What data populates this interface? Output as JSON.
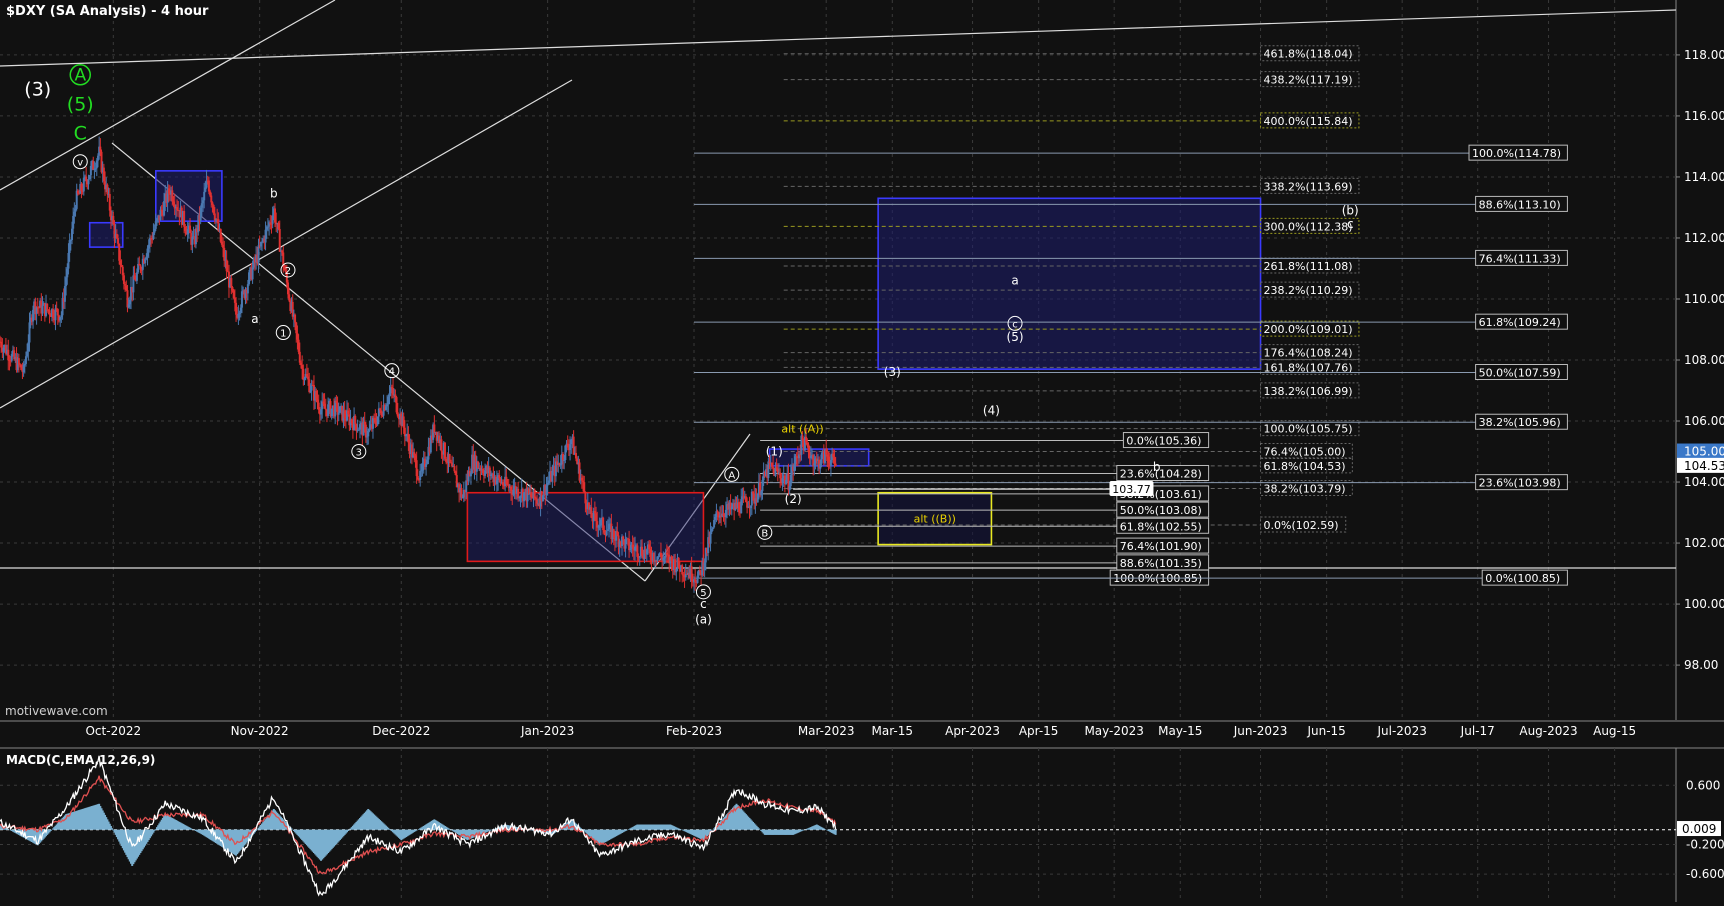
{
  "header": {
    "title": "$DXY (SA Analysis) - 4 hour"
  },
  "watermark": "motivewave.com",
  "colors": {
    "background": "#111111",
    "grid": "#3a3a3a",
    "candle_up": "#4a78b0",
    "candle_down": "#e03030",
    "blue_box": "#1f1f6a",
    "red_box": "#e01a1a",
    "yellow_box": "#e8e820",
    "green_label": "#22dd22",
    "yellow_label": "#e8d000",
    "macd_hist": "#7ab0d0",
    "macd_line": "#ffffff",
    "signal_line": "#e05050"
  },
  "chart_data": [
    {
      "type": "candlestick",
      "title": "$DXY (SA Analysis) - 4 hour",
      "x_ticks": [
        "Oct-2022",
        "Nov-2022",
        "Dec-2022",
        "Jan-2023",
        "Feb-2023",
        "Mar-2023",
        "Mar-15",
        "Apr-2023",
        "Apr-15",
        "May-2023",
        "May-15",
        "Jun-2023",
        "Jun-15",
        "Jul-2023",
        "Jul-17",
        "Aug-2023",
        "Aug-15"
      ],
      "y_ticks": [
        "98.00",
        "100.00",
        "102.00",
        "104.00",
        "106.00",
        "108.00",
        "110.00",
        "112.00",
        "114.00",
        "116.00",
        "118.00"
      ],
      "ylim": [
        96.2,
        119.8
      ],
      "x_range": [
        "2022-09-07",
        "2023-08-28"
      ],
      "grid": true,
      "price_badges": {
        "last": "105.00",
        "current": "104.53"
      },
      "pivots": [
        {
          "date": "2022-09-07",
          "price": 108.6
        },
        {
          "date": "2022-09-12",
          "price": 107.6
        },
        {
          "date": "2022-09-14",
          "price": 109.8
        },
        {
          "date": "2022-09-20",
          "price": 109.5
        },
        {
          "date": "2022-09-23",
          "price": 113.2
        },
        {
          "date": "2022-09-28",
          "price": 114.78
        },
        {
          "date": "2022-10-04",
          "price": 110.0
        },
        {
          "date": "2022-10-13",
          "price": 113.6
        },
        {
          "date": "2022-10-18",
          "price": 111.8
        },
        {
          "date": "2022-10-21",
          "price": 113.9
        },
        {
          "date": "2022-10-27",
          "price": 109.5
        },
        {
          "date": "2022-11-04",
          "price": 112.9
        },
        {
          "date": "2022-11-10",
          "price": 107.7
        },
        {
          "date": "2022-11-14",
          "price": 106.4
        },
        {
          "date": "2022-11-17",
          "price": 106.4
        },
        {
          "date": "2022-11-24",
          "price": 105.6
        },
        {
          "date": "2022-11-29",
          "price": 107.0
        },
        {
          "date": "2022-12-05",
          "price": 104.1
        },
        {
          "date": "2022-12-08",
          "price": 105.8
        },
        {
          "date": "2022-12-14",
          "price": 103.5
        },
        {
          "date": "2022-12-16",
          "price": 104.7
        },
        {
          "date": "2022-12-23",
          "price": 103.9
        },
        {
          "date": "2022-12-30",
          "price": 103.4
        },
        {
          "date": "2023-01-06",
          "price": 105.4
        },
        {
          "date": "2023-01-10",
          "price": 102.9
        },
        {
          "date": "2023-01-18",
          "price": 101.9
        },
        {
          "date": "2023-01-26",
          "price": 101.5
        },
        {
          "date": "2023-02-02",
          "price": 100.85
        },
        {
          "date": "2023-02-06",
          "price": 103.0
        },
        {
          "date": "2023-02-09",
          "price": 103.1
        },
        {
          "date": "2023-02-14",
          "price": 103.5
        },
        {
          "date": "2023-02-17",
          "price": 104.5
        },
        {
          "date": "2023-02-21",
          "price": 104.0
        },
        {
          "date": "2023-02-24",
          "price": 105.36
        },
        {
          "date": "2023-02-27",
          "price": 104.6
        },
        {
          "date": "2023-03-01",
          "price": 104.9
        },
        {
          "date": "2023-03-03",
          "price": 104.53
        }
      ],
      "fib_levels_mid": [
        {
          "label": "461.8%(118.04)",
          "price": 118.04,
          "color": "#bbbbbb"
        },
        {
          "label": "438.2%(117.19)",
          "price": 117.19,
          "color": "#bbbbbb"
        },
        {
          "label": "400.0%(115.84)",
          "price": 115.84,
          "color": "#e8e820"
        },
        {
          "label": "338.2%(113.69)",
          "price": 113.69,
          "color": "#bbbbbb"
        },
        {
          "label": "300.0%(112.38)",
          "price": 112.38,
          "color": "#e8e820"
        },
        {
          "label": "261.8%(111.08)",
          "price": 111.08,
          "color": "#bbbbbb"
        },
        {
          "label": "238.2%(110.29)",
          "price": 110.29,
          "color": "#bbbbbb"
        },
        {
          "label": "200.0%(109.01)",
          "price": 109.01,
          "color": "#e8e820"
        },
        {
          "label": "176.4%(108.24)",
          "price": 108.24,
          "color": "#bbbbbb"
        },
        {
          "label": "161.8%(107.76)",
          "price": 107.76,
          "color": "#bbbbbb"
        },
        {
          "label": "138.2%(106.99)",
          "price": 106.99,
          "color": "#bbbbbb"
        },
        {
          "label": "100.0%(105.75)",
          "price": 105.75,
          "color": "#bbbbbb"
        },
        {
          "label": "76.4%(105.00)",
          "price": 105.0,
          "color": "#bbbbbb"
        },
        {
          "label": "61.8%(104.53)",
          "price": 104.53,
          "color": "#bbbbbb"
        },
        {
          "label": "38.2%(103.79)",
          "price": 103.79,
          "color": "#bbbbbb"
        },
        {
          "label": "0.0%(102.59)",
          "price": 102.59,
          "color": "#bbbbbb"
        }
      ],
      "fib_levels_retrace": [
        {
          "label": "0.0%(105.36)",
          "price": 105.36
        },
        {
          "label": "23.6%(104.28)",
          "price": 104.28
        },
        {
          "label": "38.2%(103.61)",
          "price": 103.61
        },
        {
          "label": "50.0%(103.08)",
          "price": 103.08
        },
        {
          "label": "61.8%(102.55)",
          "price": 102.55
        },
        {
          "label": "76.4%(101.90)",
          "price": 101.9
        },
        {
          "label": "88.6%(101.35)",
          "price": 101.35
        },
        {
          "label": "100.0%(100.85)",
          "price": 100.85
        }
      ],
      "fib_levels_right": [
        {
          "label": "100.0%(114.78)",
          "price": 114.78
        },
        {
          "label": "88.6%(113.10)",
          "price": 113.1
        },
        {
          "label": "76.4%(111.33)",
          "price": 111.33
        },
        {
          "label": "61.8%(109.24)",
          "price": 109.24
        },
        {
          "label": "50.0%(107.59)",
          "price": 107.59
        },
        {
          "label": "38.2%(105.96)",
          "price": 105.96
        },
        {
          "label": "23.6%(103.98)",
          "price": 103.98
        },
        {
          "label": "0.0%(100.85)",
          "price": 100.85
        }
      ],
      "price_callout": {
        "label": "103.77",
        "price": 103.77
      },
      "boxes": [
        {
          "kind": "blue",
          "x1": "2023-03-12",
          "x2": "2023-06-01",
          "top": 113.3,
          "bottom": 107.7
        },
        {
          "kind": "blue",
          "x1": "2023-02-17",
          "x2": "2023-03-10",
          "top": 105.08,
          "bottom": 104.53
        },
        {
          "kind": "blue",
          "x1": "2022-10-10",
          "x2": "2022-10-24",
          "top": 114.2,
          "bottom": 112.55
        },
        {
          "kind": "blue",
          "x1": "2022-09-26",
          "x2": "2022-10-03",
          "top": 112.5,
          "bottom": 111.7
        },
        {
          "kind": "red",
          "x1": "2022-12-15",
          "x2": "2023-02-03",
          "top": 103.65,
          "bottom": 101.4
        },
        {
          "kind": "yellow",
          "x1": "2023-03-12",
          "x2": "2023-04-05",
          "top": 103.65,
          "bottom": 101.95,
          "label": "alt ((B))"
        }
      ],
      "wave_labels": [
        {
          "text": "b",
          "date": "2022-11-04",
          "price": 113.45,
          "style": "plain"
        },
        {
          "text": "a",
          "date": "2022-10-31",
          "price": 109.35,
          "style": "plain"
        },
        {
          "text": "2",
          "date": "2022-11-07",
          "price": 110.95,
          "style": "circle"
        },
        {
          "text": "1",
          "date": "2022-11-06",
          "price": 108.9,
          "style": "circle"
        },
        {
          "text": "4",
          "date": "2022-11-29",
          "price": 107.65,
          "style": "circle"
        },
        {
          "text": "3",
          "date": "2022-11-22",
          "price": 105.0,
          "style": "circle"
        },
        {
          "text": "5",
          "date": "2023-02-03",
          "price": 100.4,
          "style": "circle"
        },
        {
          "text": "c",
          "date": "2023-02-03",
          "price": 100.0,
          "style": "plain"
        },
        {
          "text": "(a)",
          "date": "2023-02-03",
          "price": 99.5,
          "style": "plain"
        },
        {
          "text": "A",
          "date": "2023-02-09",
          "price": 104.25,
          "style": "circle"
        },
        {
          "text": "B",
          "date": "2023-02-16",
          "price": 102.35,
          "style": "circle"
        },
        {
          "text": "(1)",
          "date": "2023-02-18",
          "price": 105.0,
          "style": "plain"
        },
        {
          "text": "(2)",
          "date": "2023-02-22",
          "price": 103.45,
          "style": "plain"
        },
        {
          "text": "(3)",
          "date": "2023-03-15",
          "price": 107.6,
          "style": "plain"
        },
        {
          "text": "(4)",
          "date": "2023-04-05",
          "price": 106.35,
          "style": "plain"
        },
        {
          "text": "a",
          "date": "2023-04-10",
          "price": 110.6,
          "style": "plain"
        },
        {
          "text": "c",
          "date": "2023-04-10",
          "price": 109.2,
          "style": "circle"
        },
        {
          "text": "(5)",
          "date": "2023-04-10",
          "price": 108.75,
          "style": "plain"
        },
        {
          "text": "b",
          "date": "2023-05-10",
          "price": 104.5,
          "style": "plain"
        },
        {
          "text": "(b)",
          "date": "2023-06-20",
          "price": 112.9,
          "style": "plain"
        },
        {
          "text": "c",
          "date": "2023-06-20",
          "price": 112.45,
          "style": "plain"
        },
        {
          "text": "alt ((A))",
          "date": "2023-02-24",
          "price": 105.75,
          "style": "yellow"
        },
        {
          "text": "(3)",
          "date": "2022-09-15",
          "price": 116.9,
          "style": "big"
        },
        {
          "text": "A",
          "date": "2022-09-24",
          "price": 117.35,
          "style": "green-circle"
        },
        {
          "text": "(5)",
          "date": "2022-09-24",
          "price": 116.4,
          "style": "green"
        },
        {
          "text": "C",
          "date": "2022-09-24",
          "price": 115.45,
          "style": "green"
        },
        {
          "text": "v",
          "date": "2022-09-24",
          "price": 114.5,
          "style": "circle"
        }
      ]
    },
    {
      "type": "line",
      "title": "MACD(C,EMA,12,26,9)",
      "y_ticks": [
        "0.600",
        "-0.200",
        "-0.600"
      ],
      "value_badge": "0.009",
      "ylim": [
        -0.95,
        1.05
      ],
      "grid": true,
      "series": [
        {
          "name": "MACD",
          "points": [
            {
              "date": "2022-09-07",
              "v": 0.1
            },
            {
              "date": "2022-09-15",
              "v": -0.15
            },
            {
              "date": "2022-09-21",
              "v": 0.3
            },
            {
              "date": "2022-09-28",
              "v": 0.95
            },
            {
              "date": "2022-10-05",
              "v": -0.25
            },
            {
              "date": "2022-10-12",
              "v": 0.35
            },
            {
              "date": "2022-10-20",
              "v": 0.15
            },
            {
              "date": "2022-10-27",
              "v": -0.45
            },
            {
              "date": "2022-11-04",
              "v": 0.45
            },
            {
              "date": "2022-11-14",
              "v": -0.9
            },
            {
              "date": "2022-11-24",
              "v": -0.1
            },
            {
              "date": "2022-12-01",
              "v": -0.3
            },
            {
              "date": "2022-12-08",
              "v": 0.05
            },
            {
              "date": "2022-12-15",
              "v": -0.2
            },
            {
              "date": "2022-12-23",
              "v": 0.05
            },
            {
              "date": "2023-01-02",
              "v": -0.05
            },
            {
              "date": "2023-01-06",
              "v": 0.15
            },
            {
              "date": "2023-01-12",
              "v": -0.35
            },
            {
              "date": "2023-01-20",
              "v": -0.15
            },
            {
              "date": "2023-01-27",
              "v": -0.05
            },
            {
              "date": "2023-02-03",
              "v": -0.25
            },
            {
              "date": "2023-02-10",
              "v": 0.55
            },
            {
              "date": "2023-02-16",
              "v": 0.35
            },
            {
              "date": "2023-02-22",
              "v": 0.25
            },
            {
              "date": "2023-02-27",
              "v": 0.3
            },
            {
              "date": "2023-03-03",
              "v": 0.05
            }
          ]
        },
        {
          "name": "Signal",
          "points": [
            {
              "date": "2022-09-07",
              "v": 0.05
            },
            {
              "date": "2022-09-15",
              "v": 0.0
            },
            {
              "date": "2022-09-21",
              "v": 0.15
            },
            {
              "date": "2022-09-28",
              "v": 0.7
            },
            {
              "date": "2022-10-05",
              "v": 0.1
            },
            {
              "date": "2022-10-12",
              "v": 0.2
            },
            {
              "date": "2022-10-20",
              "v": 0.2
            },
            {
              "date": "2022-10-27",
              "v": -0.2
            },
            {
              "date": "2022-11-04",
              "v": 0.25
            },
            {
              "date": "2022-11-14",
              "v": -0.6
            },
            {
              "date": "2022-11-24",
              "v": -0.3
            },
            {
              "date": "2022-12-01",
              "v": -0.2
            },
            {
              "date": "2022-12-08",
              "v": -0.05
            },
            {
              "date": "2022-12-15",
              "v": -0.1
            },
            {
              "date": "2022-12-23",
              "v": 0.0
            },
            {
              "date": "2023-01-02",
              "v": 0.0
            },
            {
              "date": "2023-01-06",
              "v": 0.05
            },
            {
              "date": "2023-01-12",
              "v": -0.2
            },
            {
              "date": "2023-01-20",
              "v": -0.2
            },
            {
              "date": "2023-01-27",
              "v": -0.1
            },
            {
              "date": "2023-02-03",
              "v": -0.15
            },
            {
              "date": "2023-02-10",
              "v": 0.3
            },
            {
              "date": "2023-02-16",
              "v": 0.4
            },
            {
              "date": "2023-02-22",
              "v": 0.3
            },
            {
              "date": "2023-02-27",
              "v": 0.25
            },
            {
              "date": "2023-03-03",
              "v": 0.1
            }
          ]
        }
      ]
    }
  ]
}
